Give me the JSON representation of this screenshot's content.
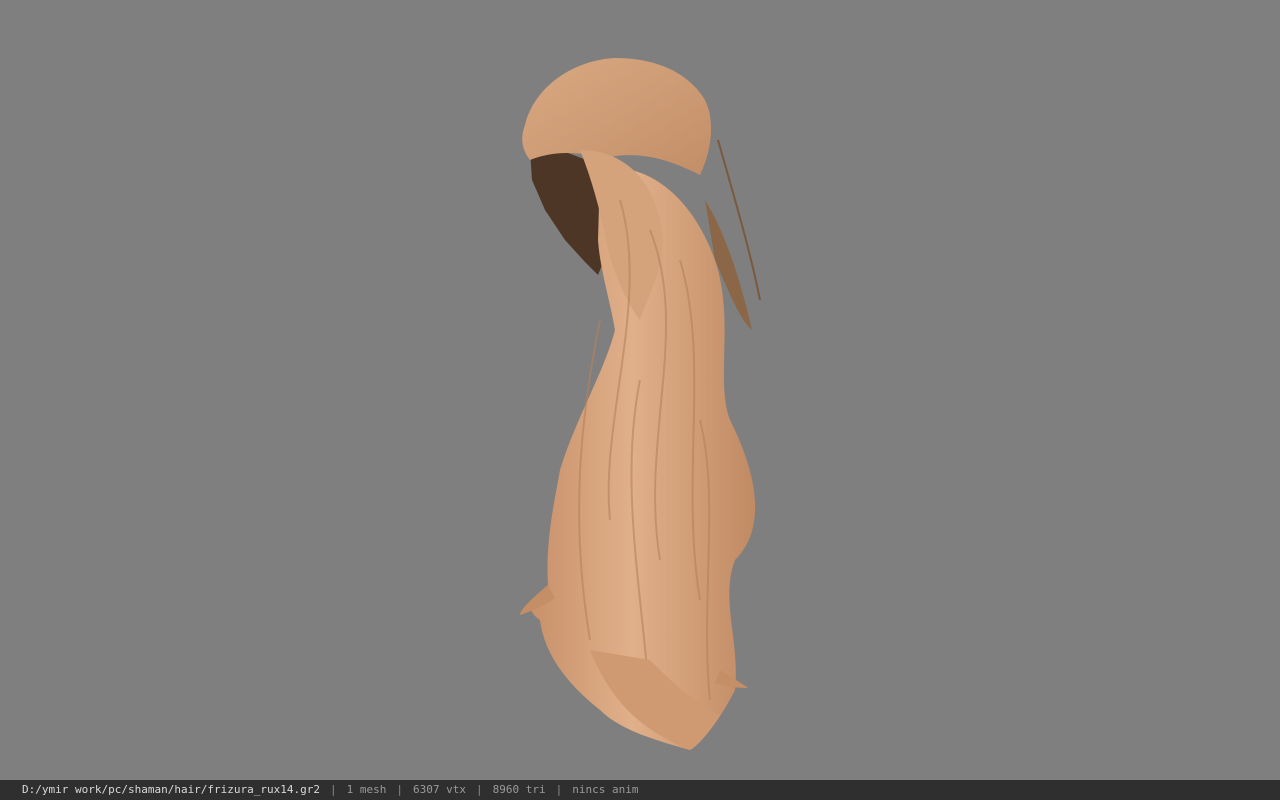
{
  "status_bar": {
    "file_path": "D:/ymir work/pc/shaman/hair/frizura_rux14.gr2",
    "separator": "|",
    "mesh_count": "1 mesh",
    "vertex_count": "6307 vtx",
    "triangle_count": "8960 tri",
    "anim_status": "nincs anim"
  },
  "viewport": {
    "background_color": "#7f7f7f",
    "model_icon": "hair-model-icon",
    "hair_color_main": "#d7a47c",
    "hair_color_shadow": "#a97a57",
    "hair_color_underside": "#4a3424"
  }
}
